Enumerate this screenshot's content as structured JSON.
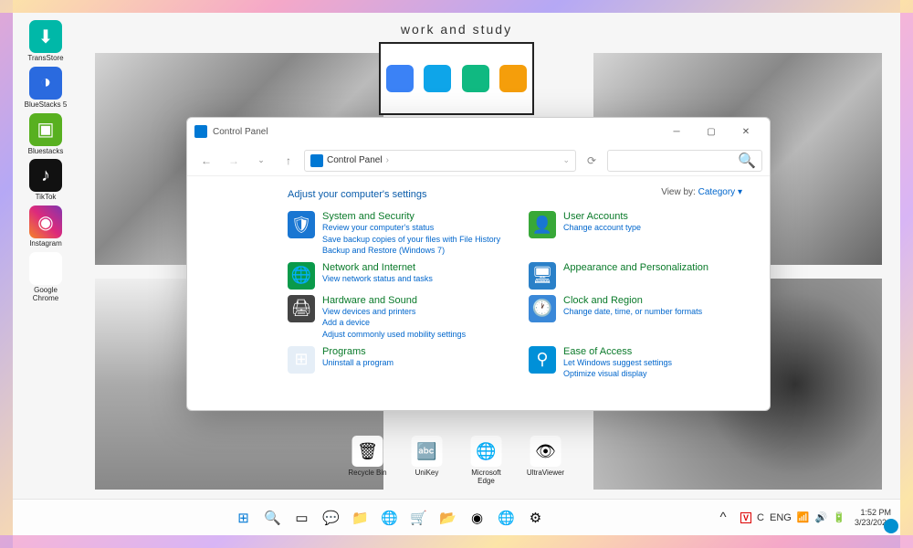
{
  "wallpaper": {
    "title": "work and study"
  },
  "desktop_icons": [
    {
      "label": "TransStore",
      "bg": "#00b8a8",
      "glyph": "⬇"
    },
    {
      "label": "BlueStacks 5",
      "bg": "#2a6adf",
      "glyph": "◑"
    },
    {
      "label": "Bluestacks",
      "bg": "#58b020",
      "glyph": "▣"
    },
    {
      "label": "TikTok",
      "bg": "#111",
      "glyph": "♪"
    },
    {
      "label": "Instagram",
      "bg": "linear-gradient(45deg,#f58529,#dd2a7b,#8134af)",
      "glyph": "◉"
    },
    {
      "label": "Google Chrome",
      "bg": "#fff",
      "glyph": "◉"
    }
  ],
  "mid_icons": [
    {
      "label": "Recycle Bin",
      "glyph": "🗑"
    },
    {
      "label": "UniKey",
      "glyph": "🔤"
    },
    {
      "label": "Microsoft Edge",
      "glyph": "🌐"
    },
    {
      "label": "UltraViewer",
      "glyph": "👁"
    }
  ],
  "window": {
    "title": "Control Panel",
    "breadcrumb": "Control Panel",
    "adjust_label": "Adjust your computer's settings",
    "viewby_label": "View by:",
    "viewby_value": "Category",
    "categories_left": [
      {
        "name": "System and Security",
        "icon_bg": "#1976d2",
        "glyph": "🛡",
        "links": [
          "Review your computer's status",
          "Save backup copies of your files with File History",
          "Backup and Restore (Windows 7)"
        ]
      },
      {
        "name": "Network and Internet",
        "icon_bg": "#0a9a4a",
        "glyph": "🌐",
        "links": [
          "View network status and tasks"
        ]
      },
      {
        "name": "Hardware and Sound",
        "icon_bg": "#444",
        "glyph": "🖨",
        "links": [
          "View devices and printers",
          "Add a device",
          "Adjust commonly used mobility settings"
        ]
      },
      {
        "name": "Programs",
        "icon_bg": "#e5eef7",
        "glyph": "⊞",
        "links": [
          "Uninstall a program"
        ]
      }
    ],
    "categories_right": [
      {
        "name": "User Accounts",
        "icon_bg": "#38a838",
        "glyph": "👤",
        "links": [
          "Change account type"
        ]
      },
      {
        "name": "Appearance and Personalization",
        "icon_bg": "#2a80c8",
        "glyph": "🖥",
        "links": []
      },
      {
        "name": "Clock and Region",
        "icon_bg": "#3a88d8",
        "glyph": "🕐",
        "links": [
          "Change date, time, or number formats"
        ]
      },
      {
        "name": "Ease of Access",
        "icon_bg": "#0090d8",
        "glyph": "⚲",
        "links": [
          "Let Windows suggest settings",
          "Optimize visual display"
        ]
      }
    ]
  },
  "taskbar": {
    "center_icons": [
      "⊞",
      "🔍",
      "▭",
      "💬",
      "📁",
      "🌐",
      "🛒",
      "📂",
      "◉",
      "🌐",
      "⚙"
    ],
    "tray": {
      "up": "^",
      "v": "V",
      "c": "C",
      "lang": "ENG",
      "wifi": "📶",
      "vol": "🔊",
      "bat": "🔋"
    },
    "time": "1:52 PM",
    "date": "3/23/2022"
  }
}
